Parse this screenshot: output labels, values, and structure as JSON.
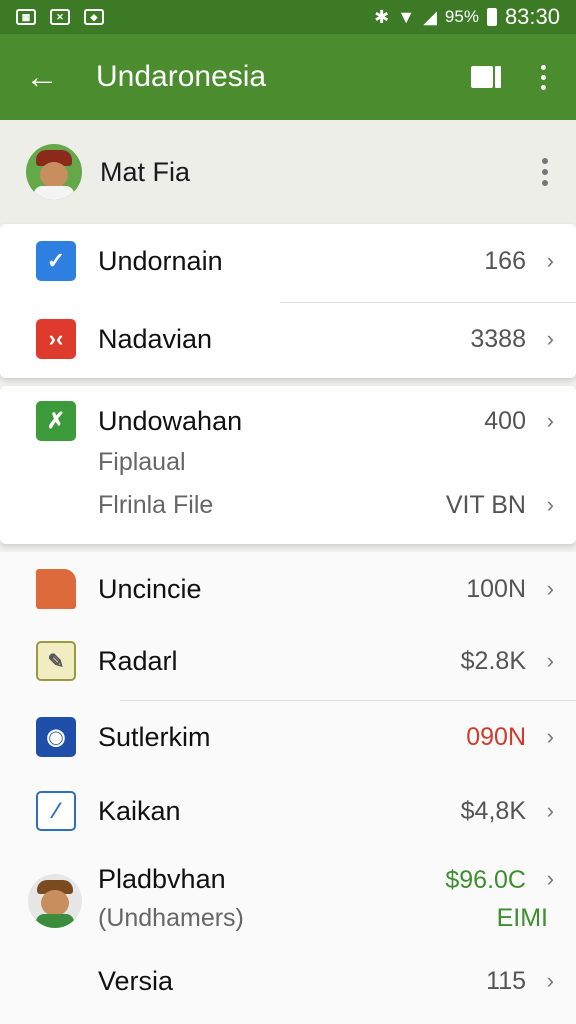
{
  "status_bar": {
    "left_icons": [
      "image-icon",
      "mail-icon",
      "chat-icon"
    ],
    "right_icons": [
      "bluetooth-icon",
      "wifi-icon",
      "signal-icon",
      "battery-icon"
    ],
    "battery": "95%",
    "time": "83:30"
  },
  "app_bar": {
    "title": "Undaronesia",
    "back_icon": "arrow-left-icon",
    "actions": [
      "book-icon",
      "more-vert-icon"
    ],
    "color": "#4a8c2e"
  },
  "profile": {
    "name": "Mat Fia"
  },
  "section1": [
    {
      "label": "Undornain",
      "value": "166",
      "icon": "checkbox-icon"
    },
    {
      "label": "Nadavian",
      "value": "3388",
      "icon": "code-icon"
    }
  ],
  "section2": {
    "label": "Undowahan",
    "value": "400",
    "sub1": "Fiplaual",
    "sub2": "Flrinla File",
    "sub2_value": "VIT BN",
    "icon": "tools-icon"
  },
  "section3": [
    {
      "label": "Uncincie",
      "value": "100N",
      "icon": "folder-icon"
    },
    {
      "label": "Radarl",
      "value": "$2.8K",
      "icon": "document-icon"
    },
    {
      "label": "Sutlerkim",
      "value": "090N",
      "value_color": "#d23b2b",
      "icon": "camera-icon"
    },
    {
      "label": "Kaikan",
      "value": "$4,8K",
      "icon": "edit-icon"
    }
  ],
  "pladbvhan": {
    "label": "Pladbvhan",
    "sub": "(Undhamers)",
    "value": "$96.0C",
    "sub_value": "EIMI",
    "value_color": "#3d8f2e",
    "icon": "avatar"
  },
  "versia": {
    "label": "Versia",
    "value": "115"
  }
}
